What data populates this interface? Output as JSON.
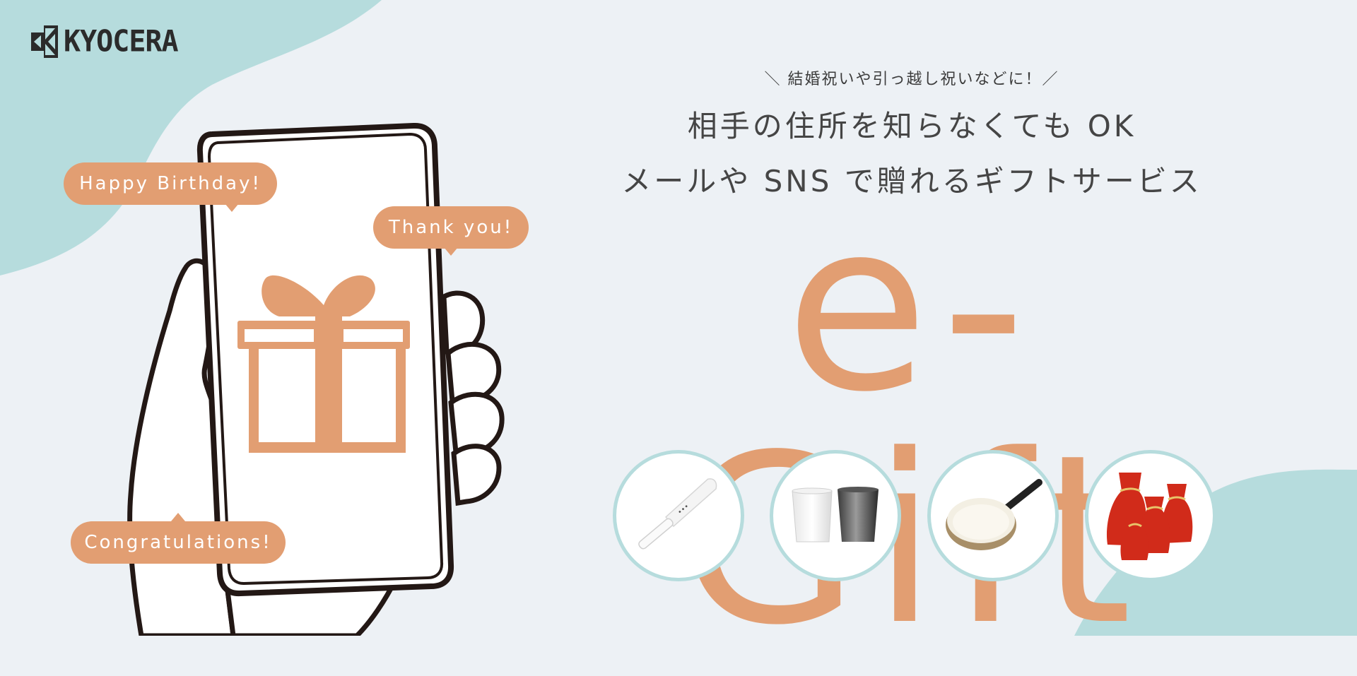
{
  "brand": {
    "logo_text": "KYOCERA",
    "logo_icon": "kyocera-logo-mark-icon"
  },
  "headline": {
    "subtitle": "＼ 結婚祝いや引っ越し祝いなどに！／",
    "line1": "相手の住所を知らなくても OK",
    "line2": "メールや SNS で贈れるギフトサービス",
    "wordmark": "e-Gift"
  },
  "bubbles": [
    {
      "text": "Happy Birthday!"
    },
    {
      "text": "Thank you!"
    },
    {
      "text": "Congratulations!"
    }
  ],
  "illustration": {
    "phone_icon": "hand-holding-phone-icon",
    "gift_icon": "gift-box-icon"
  },
  "products": [
    {
      "name": "ceramic-knife",
      "icon": "knife-icon"
    },
    {
      "name": "tumblers",
      "icon": "tumbler-pair-icon"
    },
    {
      "name": "frying-pan",
      "icon": "frying-pan-icon"
    },
    {
      "name": "gift-wrapping-bags",
      "icon": "gift-bags-icon"
    }
  ],
  "colors": {
    "background": "#EDF1F5",
    "teal": "#B6DCDD",
    "accent_orange": "#E29E72",
    "text_dark": "#454545",
    "outline": "#231815"
  }
}
